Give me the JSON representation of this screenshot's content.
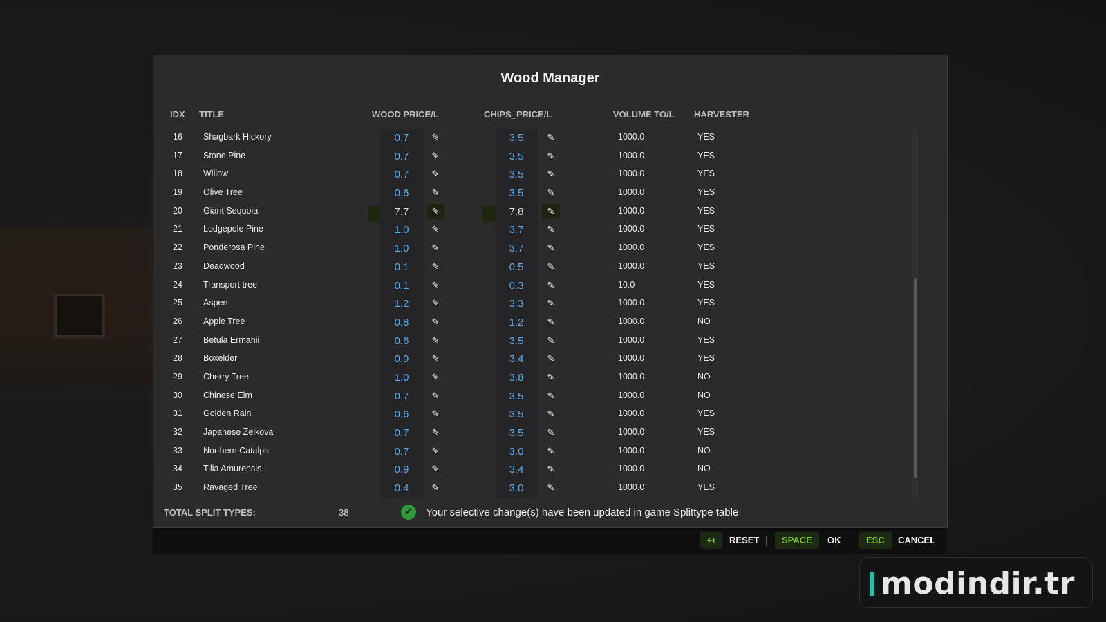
{
  "dialog": {
    "title": "Wood Manager"
  },
  "columns": {
    "idx": "IDX",
    "title": "TITLE",
    "wood": "WOOD PRICE/L",
    "chips": "CHIPS_PRICE/L",
    "volume": "VOLUME TO/L",
    "harvester": "HARVESTER"
  },
  "rows": [
    {
      "idx": "16",
      "title": "Shagbark Hickory",
      "wood": "0.7",
      "chips": "3.5",
      "volume": "1000.0",
      "harvester": "YES"
    },
    {
      "idx": "17",
      "title": "Stone Pine",
      "wood": "0.7",
      "chips": "3.5",
      "volume": "1000.0",
      "harvester": "YES"
    },
    {
      "idx": "18",
      "title": "Willow",
      "wood": "0.7",
      "chips": "3.5",
      "volume": "1000.0",
      "harvester": "YES"
    },
    {
      "idx": "19",
      "title": "Olive Tree",
      "wood": "0.6",
      "chips": "3.5",
      "volume": "1000.0",
      "harvester": "YES"
    },
    {
      "idx": "20",
      "title": "Giant Sequoia",
      "wood": "7.7",
      "chips": "7.8",
      "volume": "1000.0",
      "harvester": "YES",
      "selected": true
    },
    {
      "idx": "21",
      "title": "Lodgepole Pine",
      "wood": "1.0",
      "chips": "3.7",
      "volume": "1000.0",
      "harvester": "YES"
    },
    {
      "idx": "22",
      "title": "Ponderosa Pine",
      "wood": "1.0",
      "chips": "3.7",
      "volume": "1000.0",
      "harvester": "YES"
    },
    {
      "idx": "23",
      "title": "Deadwood",
      "wood": "0.1",
      "chips": "0.5",
      "volume": "1000.0",
      "harvester": "YES"
    },
    {
      "idx": "24",
      "title": "Transport tree",
      "wood": "0.1",
      "chips": "0.3",
      "volume": "10.0",
      "harvester": "YES"
    },
    {
      "idx": "25",
      "title": "Aspen",
      "wood": "1.2",
      "chips": "3.3",
      "volume": "1000.0",
      "harvester": "YES"
    },
    {
      "idx": "26",
      "title": "Apple Tree",
      "wood": "0.8",
      "chips": "1.2",
      "volume": "1000.0",
      "harvester": "NO"
    },
    {
      "idx": "27",
      "title": "Betula Ermanii",
      "wood": "0.6",
      "chips": "3.5",
      "volume": "1000.0",
      "harvester": "YES"
    },
    {
      "idx": "28",
      "title": "Boxelder",
      "wood": "0.9",
      "chips": "3.4",
      "volume": "1000.0",
      "harvester": "YES"
    },
    {
      "idx": "29",
      "title": "Cherry Tree",
      "wood": "1.0",
      "chips": "3.8",
      "volume": "1000.0",
      "harvester": "NO"
    },
    {
      "idx": "30",
      "title": "Chinese Elm",
      "wood": "0.7",
      "chips": "3.5",
      "volume": "1000.0",
      "harvester": "NO"
    },
    {
      "idx": "31",
      "title": "Golden Rain",
      "wood": "0.6",
      "chips": "3.5",
      "volume": "1000.0",
      "harvester": "YES"
    },
    {
      "idx": "32",
      "title": "Japanese Zelkova",
      "wood": "0.7",
      "chips": "3.5",
      "volume": "1000.0",
      "harvester": "YES"
    },
    {
      "idx": "33",
      "title": "Northern Catalpa",
      "wood": "0.7",
      "chips": "3.0",
      "volume": "1000.0",
      "harvester": "NO"
    },
    {
      "idx": "34",
      "title": "Tilia Amurensis",
      "wood": "0.9",
      "chips": "3.4",
      "volume": "1000.0",
      "harvester": "NO"
    },
    {
      "idx": "35",
      "title": "Ravaged Tree",
      "wood": "0.4",
      "chips": "3.0",
      "volume": "1000.0",
      "harvester": "YES"
    }
  ],
  "footer": {
    "total_label": "TOTAL SPLIT TYPES:",
    "total_count": "38",
    "status": "Your selective change(s) have been updated in game Splittype table"
  },
  "actions": {
    "reset_key": "↤",
    "reset_label": "RESET",
    "ok_key": "SPACE",
    "ok_label": "OK",
    "cancel_key": "ESC",
    "cancel_label": "CANCEL"
  },
  "brand": {
    "text": "modindir.tr"
  },
  "icons": {
    "edit": "pencil-icon",
    "status": "check-circle-icon"
  },
  "colors": {
    "value_blue": "#5aa8ea",
    "key_green": "#7fbf2a",
    "check_green": "#2f9a3a"
  }
}
